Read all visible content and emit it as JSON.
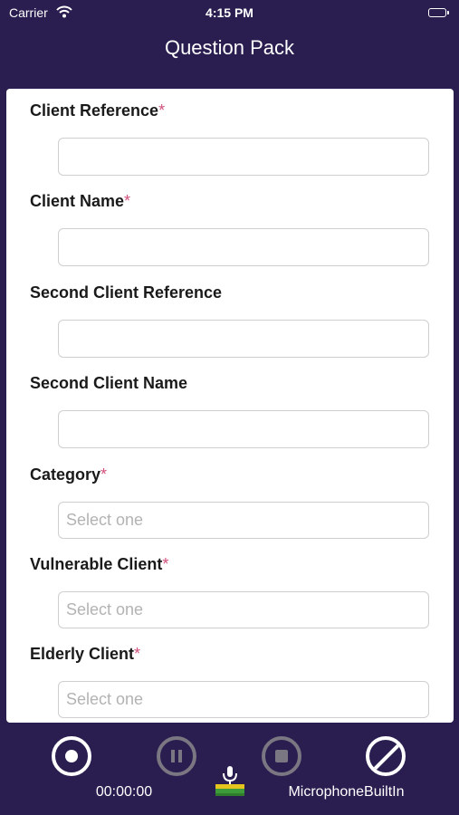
{
  "status_bar": {
    "carrier": "Carrier",
    "time": "4:15 PM",
    "icons": [
      "wifi-icon",
      "battery-icon"
    ]
  },
  "nav": {
    "title": "Question Pack"
  },
  "form": {
    "required_marker": "*",
    "client_reference": {
      "label": "Client Reference",
      "required": true,
      "value": ""
    },
    "client_name": {
      "label": "Client Name",
      "required": true,
      "value": ""
    },
    "second_client_reference": {
      "label": "Second Client Reference",
      "required": false,
      "value": ""
    },
    "second_client_name": {
      "label": "Second Client Name",
      "required": false,
      "value": ""
    },
    "category": {
      "label": "Category",
      "required": true,
      "placeholder": "Select one"
    },
    "vulnerable_client": {
      "label": "Vulnerable Client",
      "required": true,
      "placeholder": "Select one"
    },
    "elderly_client": {
      "label": "Elderly Client",
      "required": true,
      "placeholder": "Select one"
    }
  },
  "recorder": {
    "timer": "00:00:00",
    "input_source": "MicrophoneBuiltIn",
    "controls": [
      "record-icon",
      "pause-icon",
      "stop-icon",
      "cancel-icon"
    ],
    "colors": {
      "active": "#ffffff",
      "disabled": "#7a7682",
      "background": "#2a1d4f",
      "required_marker": "#d0507a"
    }
  }
}
